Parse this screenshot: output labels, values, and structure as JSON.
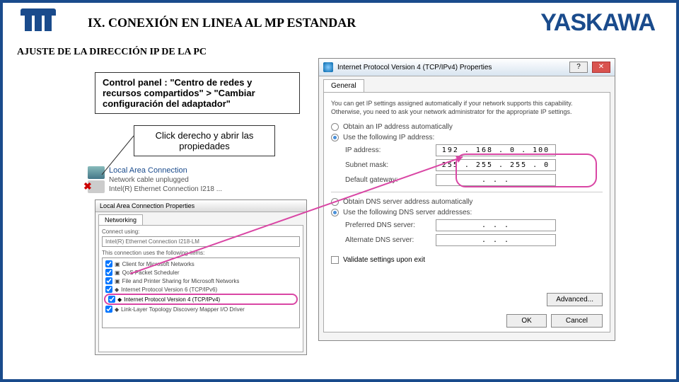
{
  "header": {
    "section_title": "IX.  CONEXIÓN EN LINEA AL MP ESTANDAR",
    "brand": "YASKAWA"
  },
  "subtitle": "AJUSTE DE LA DIRECCIÓN IP DE LA PC",
  "instruction": "Control panel : \"Centro de redes y recursos compartidos\" > \"Cambiar configuración del adaptador\"",
  "click_instruction": "Click derecho y abrir las propiedades",
  "lac": {
    "title": "Local Area Connection",
    "status": "Network cable unplugged",
    "adapter": "Intel(R) Ethernet Connection I218 ..."
  },
  "props": {
    "title": "Local Area Connection Properties",
    "tab": "Networking",
    "connect_using": "Intel(R) Ethernet Connection I218-LM",
    "items": [
      "Client for Microsoft Networks",
      "QoS Packet Scheduler",
      "File and Printer Sharing for Microsoft Networks",
      "Internet Protocol Version 6 (TCP/IPv6)",
      "Internet Protocol Version 4 (TCP/IPv4)",
      "Link-Layer Topology Discovery Mapper I/O Driver"
    ]
  },
  "ipv4": {
    "title": "Internet Protocol Version 4 (TCP/IPv4) Properties",
    "tab": "General",
    "desc": "You can get IP settings assigned automatically if your network supports this capability. Otherwise, you need to ask your network administrator for the appropriate IP settings.",
    "radio_auto_ip": "Obtain an IP address automatically",
    "radio_use_ip": "Use the following IP address:",
    "ip_label": "IP address:",
    "ip_value": "192 . 168 .  0  . 100",
    "subnet_label": "Subnet mask:",
    "subnet_value": "255 . 255 . 255 .  0",
    "gateway_label": "Default gateway:",
    "gateway_value": ".       .       .",
    "radio_auto_dns": "Obtain DNS server address automatically",
    "radio_use_dns": "Use the following DNS server addresses:",
    "pref_dns_label": "Preferred DNS server:",
    "pref_dns_value": ".       .       .",
    "alt_dns_label": "Alternate DNS server:",
    "alt_dns_value": ".       .       .",
    "validate": "Validate settings upon exit",
    "advanced": "Advanced...",
    "ok": "OK",
    "cancel": "Cancel"
  }
}
